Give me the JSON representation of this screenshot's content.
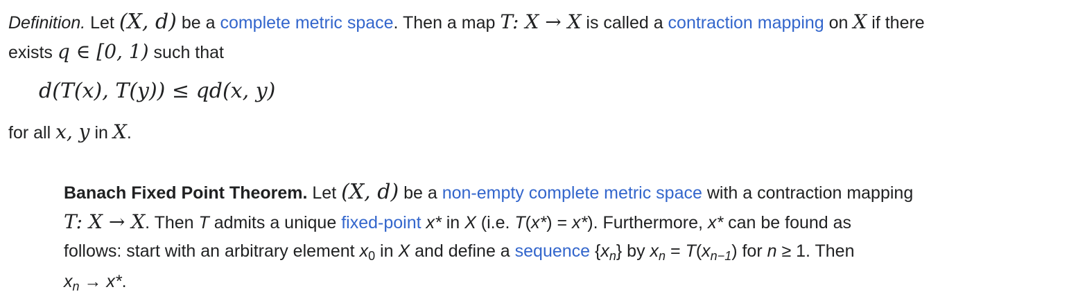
{
  "definition": {
    "label": "Definition.",
    "t1": " Let ",
    "m_space": "(X, d)",
    "t2": " be a ",
    "link_complete": "complete metric space",
    "t3": ". Then a map ",
    "m_map": "T: X → X",
    "t4": " is called a ",
    "link_contraction": "contraction mapping",
    "t5": " on ",
    "m_X1": "X",
    "t6": " if there",
    "t7": "exists ",
    "m_q": "q ∈ [0, 1)",
    "t8": " such that",
    "formula": "d(T(x), T(y)) ≤ qd(x, y)",
    "t9": "for all ",
    "m_xy": "x, y",
    "t10": " in ",
    "m_X2": "X",
    "t11": "."
  },
  "theorem": {
    "label": "Banach Fixed Point Theorem.",
    "t1": " Let ",
    "m_space": "(X, d)",
    "t2": " be a ",
    "link_nonempty": "non-empty complete metric space",
    "t3": " with a contraction mapping",
    "m_map": "T: X → X",
    "t4": ". Then ",
    "i_T": "T",
    "t5": " admits a unique ",
    "link_fixed": "fixed-point",
    "t6": " ",
    "i_xstar1": "x*",
    "t7": " in ",
    "i_X1": "X",
    "t8": " (i.e. ",
    "i_Tx": "T",
    "t9": "(",
    "i_xstar2": "x*",
    "t10": ") = ",
    "i_xstar3": "x*",
    "t11": "). Furthermore, ",
    "i_xstar4": "x*",
    "t12": " can be found as",
    "t13": "follows: start with an arbitrary element ",
    "i_x0": "x",
    "sub_0": "0",
    "t14": " in ",
    "i_X2": "X",
    "t15": " and define a ",
    "link_sequence": "sequence",
    "t16": " {",
    "i_xn1": "x",
    "sub_n1": "n",
    "t17": "} by ",
    "i_xn2": "x",
    "sub_n2": "n",
    "t18": " = ",
    "i_T2": "T",
    "t19": "(",
    "i_xn3": "x",
    "sub_n3": "n−1",
    "t20": ") for ",
    "i_n": "n",
    "t21": " ≥ 1. Then",
    "i_xn4": "x",
    "sub_n4": "n",
    "t22": " → ",
    "i_xstar5": "x*",
    "t23": "."
  }
}
